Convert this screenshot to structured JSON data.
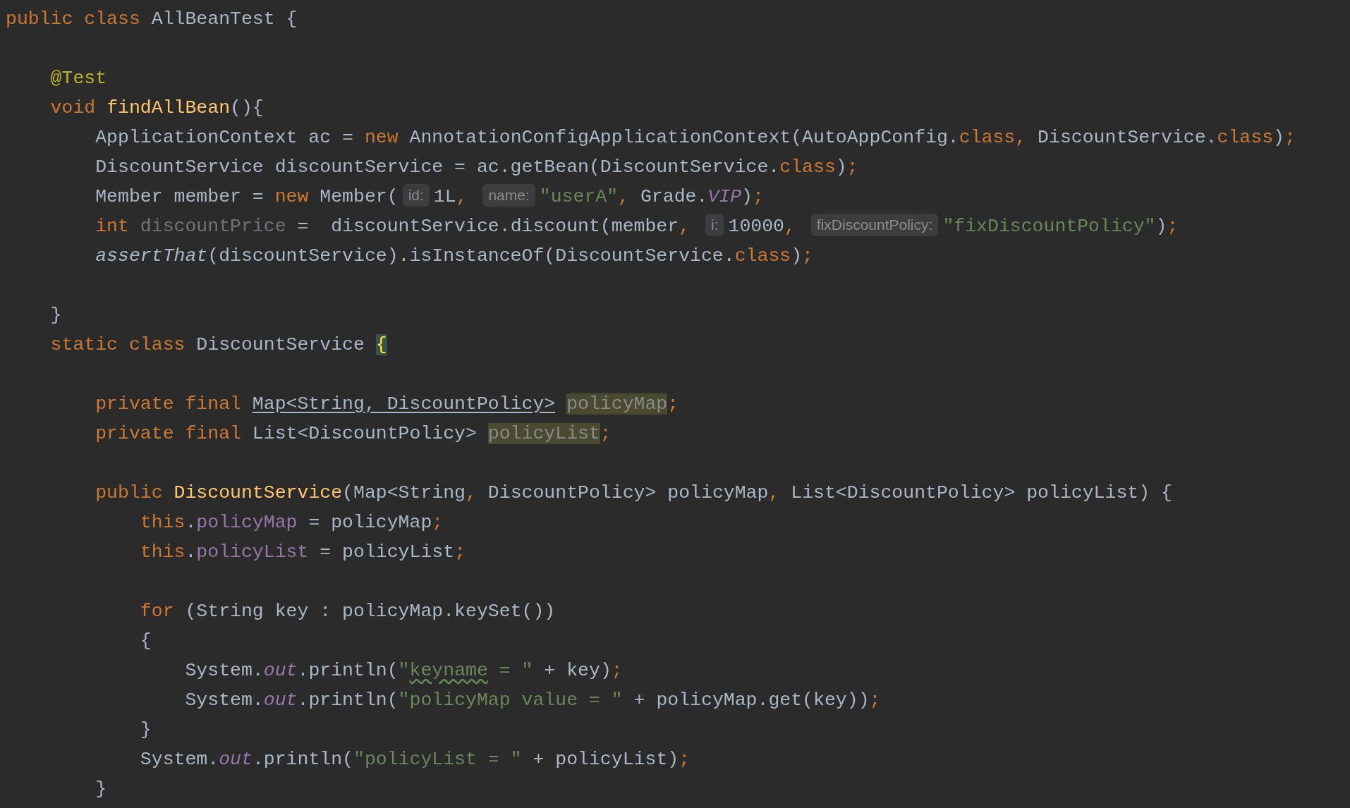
{
  "editor": {
    "lines": [
      {
        "kind": "code",
        "tokens": [
          {
            "kind": "kw",
            "text": "public class "
          },
          {
            "kind": "plain",
            "text": "AllBeanTest {"
          }
        ],
        "children": [
          {
            "kind": "blank"
          },
          {
            "kind": "code",
            "tokens": [
              {
                "kind": "ann",
                "text": "@Test"
              }
            ]
          },
          {
            "kind": "code",
            "tokens": [
              {
                "kind": "kw",
                "text": "void "
              },
              {
                "kind": "decl",
                "text": "findAllBean"
              },
              {
                "kind": "plain",
                "text": "(){"
              }
            ],
            "children": [
              {
                "kind": "code",
                "tokens": [
                  {
                    "kind": "plain",
                    "text": "ApplicationContext ac = "
                  },
                  {
                    "kind": "kw",
                    "text": "new "
                  },
                  {
                    "kind": "plain",
                    "text": "AnnotationConfigApplicationContext(AutoAppConfig."
                  },
                  {
                    "kind": "kw",
                    "text": "class, "
                  },
                  {
                    "kind": "plain",
                    "text": "DiscountService."
                  },
                  {
                    "kind": "kw",
                    "text": "class"
                  },
                  {
                    "kind": "plain",
                    "text": ")"
                  },
                  {
                    "kind": "kw",
                    "text": ";"
                  }
                ]
              },
              {
                "kind": "code",
                "tokens": [
                  {
                    "kind": "plain",
                    "text": "DiscountService discountService = ac.getBean(DiscountService."
                  },
                  {
                    "kind": "kw",
                    "text": "class"
                  },
                  {
                    "kind": "plain",
                    "text": ")"
                  },
                  {
                    "kind": "kw",
                    "text": ";"
                  }
                ]
              },
              {
                "kind": "code",
                "tokens": [
                  {
                    "kind": "plain",
                    "text": "Member member = "
                  },
                  {
                    "kind": "kw",
                    "text": "new "
                  },
                  {
                    "kind": "plain",
                    "text": "Member("
                  },
                  {
                    "kind": "hint",
                    "text": "id:"
                  },
                  {
                    "kind": "plain",
                    "text": "1L"
                  },
                  {
                    "kind": "kw",
                    "text": ", "
                  },
                  {
                    "kind": "hint",
                    "text": "name:"
                  },
                  {
                    "kind": "str",
                    "text": "\"userA\""
                  },
                  {
                    "kind": "kw",
                    "text": ", "
                  },
                  {
                    "kind": "plain",
                    "text": "Grade."
                  },
                  {
                    "kind": "static",
                    "text": "VIP"
                  },
                  {
                    "kind": "plain",
                    "text": ")"
                  },
                  {
                    "kind": "kw",
                    "text": ";"
                  }
                ]
              },
              {
                "kind": "code",
                "tokens": [
                  {
                    "kind": "kw",
                    "text": "int "
                  },
                  {
                    "kind": "unused",
                    "text": "discountPrice"
                  },
                  {
                    "kind": "plain",
                    "text": " =  discountService.discount(member"
                  },
                  {
                    "kind": "kw",
                    "text": ", "
                  },
                  {
                    "kind": "hint",
                    "text": "i:"
                  },
                  {
                    "kind": "plain",
                    "text": "10000"
                  },
                  {
                    "kind": "kw",
                    "text": ", "
                  },
                  {
                    "kind": "hint",
                    "text": "fixDiscountPolicy:"
                  },
                  {
                    "kind": "str",
                    "text": "\"fixDiscountPolicy\""
                  },
                  {
                    "kind": "plain",
                    "text": ")"
                  },
                  {
                    "kind": "kw",
                    "text": ";"
                  }
                ]
              },
              {
                "kind": "code",
                "tokens": [
                  {
                    "kind": "italic",
                    "text": "assertThat"
                  },
                  {
                    "kind": "plain",
                    "text": "(discountService).isInstanceOf(DiscountService."
                  },
                  {
                    "kind": "kw",
                    "text": "class"
                  },
                  {
                    "kind": "plain",
                    "text": ")"
                  },
                  {
                    "kind": "kw",
                    "text": ";"
                  }
                ]
              },
              {
                "kind": "blank"
              }
            ]
          },
          {
            "kind": "code",
            "tokens": [
              {
                "kind": "plain",
                "text": "}"
              }
            ]
          },
          {
            "kind": "code",
            "tokens": [
              {
                "kind": "kw",
                "text": "static class "
              },
              {
                "kind": "plain",
                "text": "DiscountService "
              },
              {
                "kind": "brace",
                "text": "{"
              }
            ],
            "children": [
              {
                "kind": "blank"
              },
              {
                "kind": "code",
                "tokens": [
                  {
                    "kind": "kw",
                    "text": "private final "
                  },
                  {
                    "kind": "link",
                    "text": "Map<String, DiscountPolicy>"
                  },
                  {
                    "kind": "usage",
                    "text": "policyMap"
                  },
                  {
                    "kind": "kw",
                    "text": ";"
                  }
                ]
              },
              {
                "kind": "code",
                "tokens": [
                  {
                    "kind": "kw",
                    "text": "private final "
                  },
                  {
                    "kind": "plain",
                    "text": "List<DiscountPolicy>"
                  },
                  {
                    "kind": "usage",
                    "text": "policyList"
                  },
                  {
                    "kind": "kw",
                    "text": ";"
                  }
                ]
              },
              {
                "kind": "blank"
              },
              {
                "kind": "code",
                "tokens": [
                  {
                    "kind": "kw",
                    "text": "public "
                  },
                  {
                    "kind": "decl",
                    "text": "DiscountService"
                  },
                  {
                    "kind": "plain",
                    "text": "(Map<String"
                  },
                  {
                    "kind": "kw",
                    "text": ", "
                  },
                  {
                    "kind": "plain",
                    "text": "DiscountPolicy> policyMap"
                  },
                  {
                    "kind": "kw",
                    "text": ", "
                  },
                  {
                    "kind": "plain",
                    "text": "List<DiscountPolicy> policyList) {"
                  }
                ],
                "children": [
                  {
                    "kind": "code",
                    "tokens": [
                      {
                        "kind": "kw",
                        "text": "this"
                      },
                      {
                        "kind": "plain",
                        "text": "."
                      },
                      {
                        "kind": "field",
                        "text": "policyMap"
                      },
                      {
                        "kind": "plain",
                        "text": " = policyMap"
                      },
                      {
                        "kind": "kw",
                        "text": ";"
                      }
                    ]
                  },
                  {
                    "kind": "code",
                    "tokens": [
                      {
                        "kind": "kw",
                        "text": "this"
                      },
                      {
                        "kind": "plain",
                        "text": "."
                      },
                      {
                        "kind": "field",
                        "text": "policyList"
                      },
                      {
                        "kind": "plain",
                        "text": " = policyList"
                      },
                      {
                        "kind": "kw",
                        "text": ";"
                      }
                    ]
                  },
                  {
                    "kind": "blank"
                  },
                  {
                    "kind": "code",
                    "tokens": [
                      {
                        "kind": "kw",
                        "text": "for "
                      },
                      {
                        "kind": "plain",
                        "text": "(String key : policyMap.keySet())"
                      }
                    ]
                  },
                  {
                    "kind": "code",
                    "tokens": [
                      {
                        "kind": "plain",
                        "text": "{"
                      }
                    ],
                    "children": [
                      {
                        "kind": "code",
                        "tokens": [
                          {
                            "kind": "plain",
                            "text": "System."
                          },
                          {
                            "kind": "static",
                            "text": "out"
                          },
                          {
                            "kind": "plain",
                            "text": ".println("
                          },
                          {
                            "kind": "str",
                            "text": "\""
                          },
                          {
                            "kind": "typo",
                            "text": "keyname"
                          },
                          {
                            "kind": "str",
                            "text": " = \""
                          },
                          {
                            "kind": "plain",
                            "text": " + key)"
                          },
                          {
                            "kind": "kw",
                            "text": ";"
                          }
                        ]
                      },
                      {
                        "kind": "code",
                        "tokens": [
                          {
                            "kind": "plain",
                            "text": "System."
                          },
                          {
                            "kind": "static",
                            "text": "out"
                          },
                          {
                            "kind": "plain",
                            "text": ".println("
                          },
                          {
                            "kind": "str",
                            "text": "\"policyMap value = \""
                          },
                          {
                            "kind": "plain",
                            "text": " + policyMap.get(key))"
                          },
                          {
                            "kind": "kw",
                            "text": ";"
                          }
                        ]
                      }
                    ]
                  },
                  {
                    "kind": "code",
                    "tokens": [
                      {
                        "kind": "plain",
                        "text": "}"
                      }
                    ]
                  },
                  {
                    "kind": "code",
                    "tokens": [
                      {
                        "kind": "plain",
                        "text": "System."
                      },
                      {
                        "kind": "static",
                        "text": "out"
                      },
                      {
                        "kind": "plain",
                        "text": ".println("
                      },
                      {
                        "kind": "str",
                        "text": "\"policyList = \""
                      },
                      {
                        "kind": "plain",
                        "text": " + policyList)"
                      },
                      {
                        "kind": "kw",
                        "text": ";"
                      }
                    ]
                  }
                ]
              },
              {
                "kind": "code",
                "tokens": [
                  {
                    "kind": "plain",
                    "text": "}"
                  }
                ]
              }
            ]
          }
        ]
      }
    ]
  }
}
